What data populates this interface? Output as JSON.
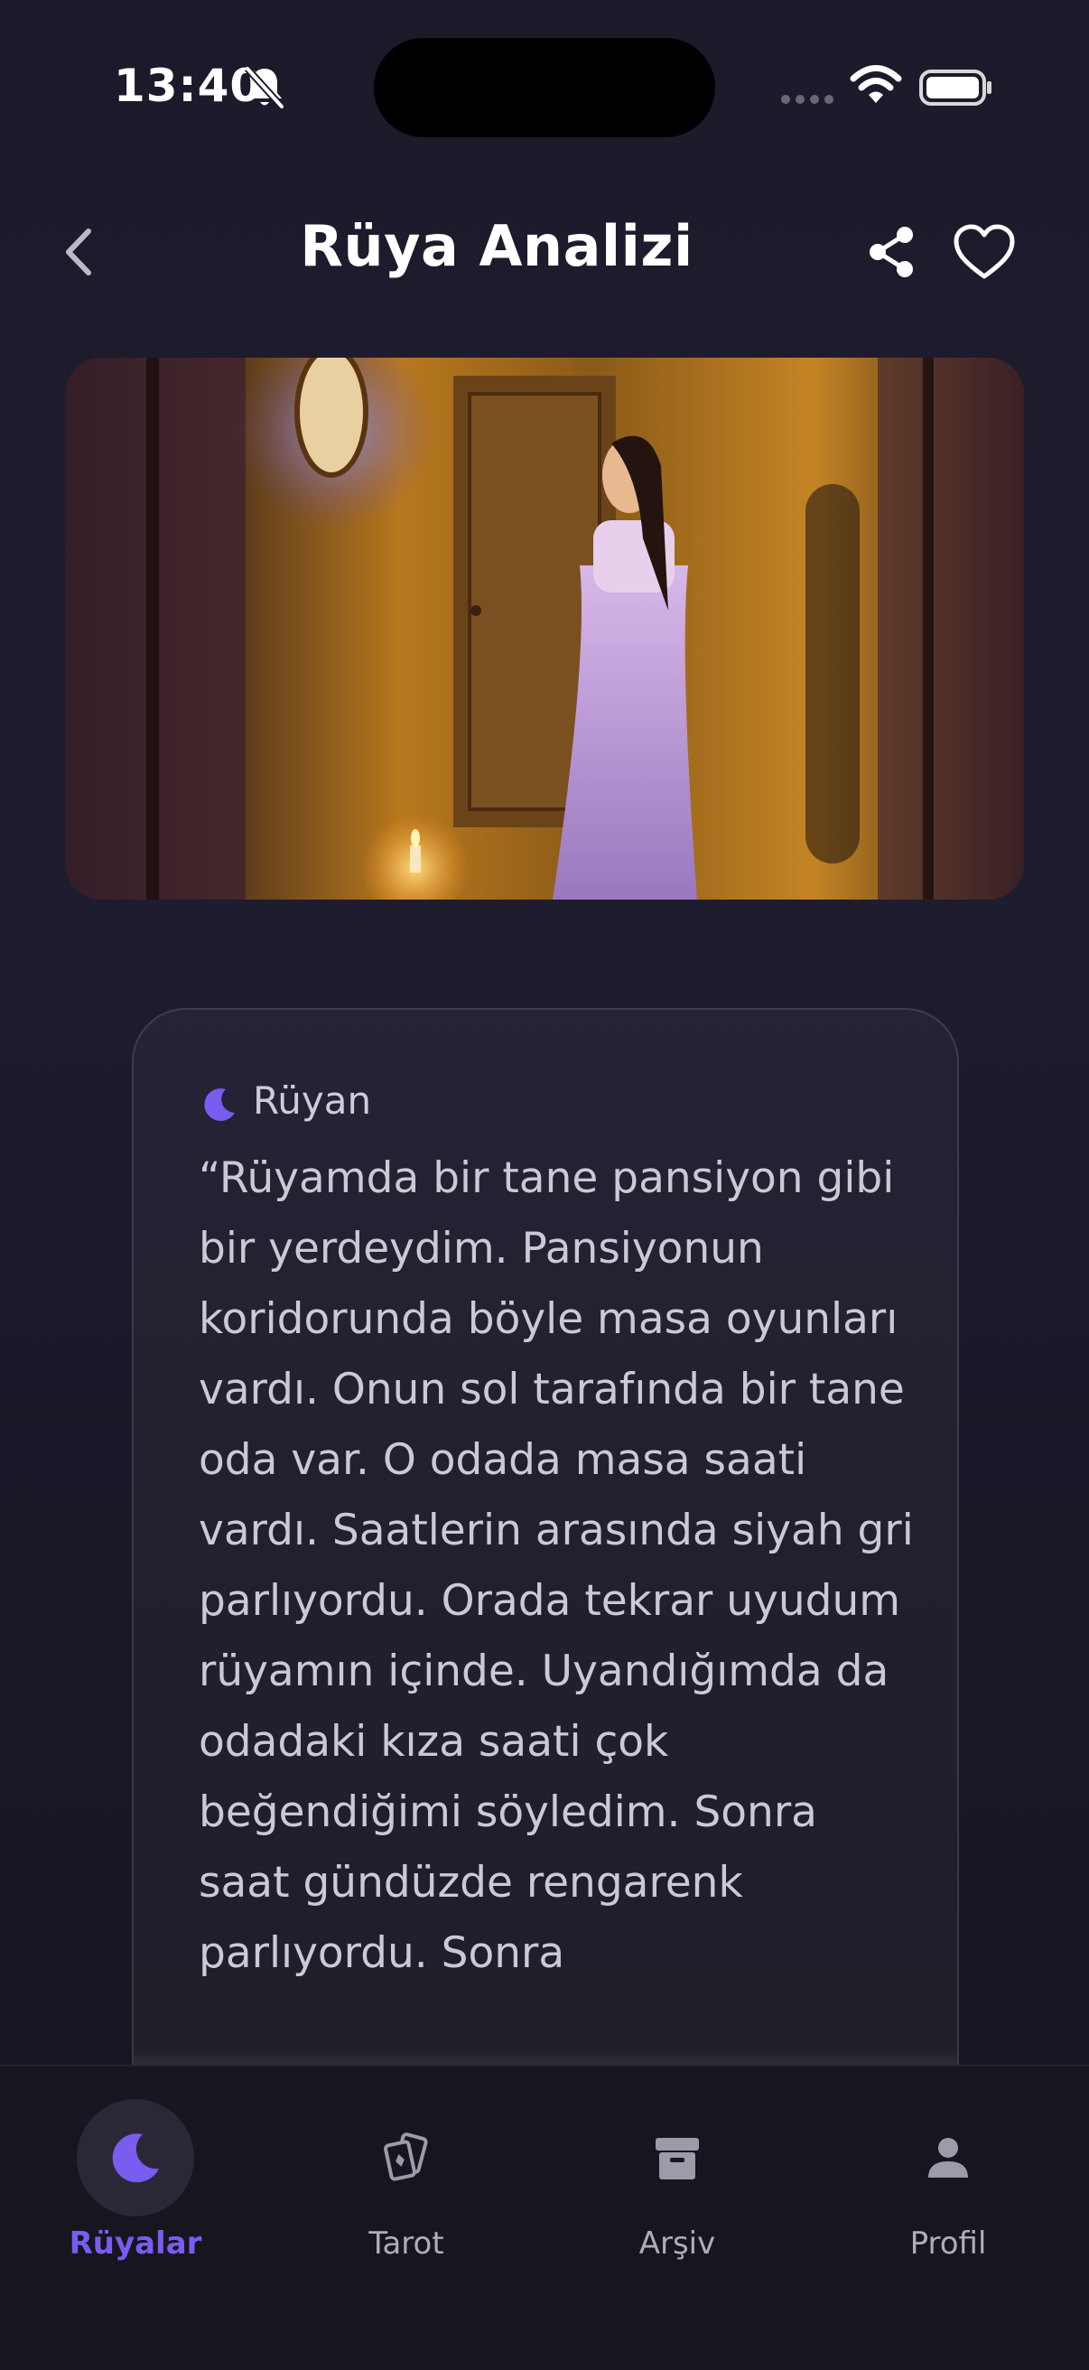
{
  "status_bar": {
    "time": "13:40"
  },
  "header": {
    "title": "Rüya Analizi"
  },
  "card": {
    "label": "Rüyan",
    "dream_text": "“Rüyamda bir tane pansiyon gibi bir yerdeydim. Pansiyonun koridorunda böyle masa oyunları vardı. Onun sol tarafında bir tane oda var. O odada masa saati vardı. Saatlerin arasında siyah gri parlıyordu. Orada tekrar uyudum rüyamın içinde. Uyandığımda da odadaki kıza saati çok beğendiğimi söyledim. Sonra saat gündüzde rengarenk parlıyordu. Sonra"
  },
  "nav": {
    "items": [
      {
        "label": "Rüyalar",
        "icon": "moon-icon",
        "active": true
      },
      {
        "label": "Tarot",
        "icon": "tarot-cards-icon",
        "active": false
      },
      {
        "label": "Arşiv",
        "icon": "archive-box-icon",
        "active": false
      },
      {
        "label": "Profil",
        "icon": "person-icon",
        "active": false
      }
    ]
  },
  "colors": {
    "accent": "#7a5cf0",
    "background": "#1c1a2a",
    "nav_bg": "#17151f"
  }
}
